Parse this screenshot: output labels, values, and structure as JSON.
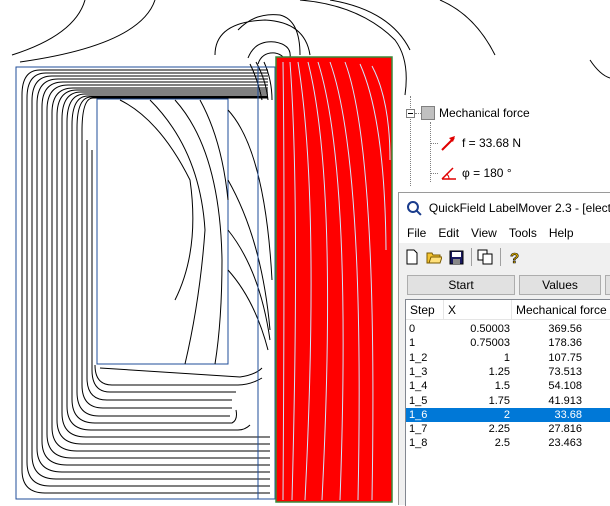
{
  "tree": {
    "node_label": "Mechanical force",
    "force_label": "f = 33.68 N",
    "angle_label": "φ = 180 °"
  },
  "window": {
    "title": "QuickField LabelMover 2.3 - [elect",
    "menu": [
      "File",
      "Edit",
      "View",
      "Tools",
      "Help"
    ],
    "toolbar_icons": [
      "new-icon",
      "open-icon",
      "save-icon",
      "copy-icon",
      "help-icon"
    ],
    "start_label": "Start",
    "values_label": "Values",
    "table": {
      "columns": [
        "Step",
        "X",
        "Mechanical force"
      ],
      "rows": [
        {
          "step": "0",
          "x": "0.50003",
          "force": "369.56"
        },
        {
          "step": "1",
          "x": "0.75003",
          "force": "178.36"
        },
        {
          "step": "1_2",
          "x": "1",
          "force": "107.75"
        },
        {
          "step": "1_3",
          "x": "1.25",
          "force": "73.513"
        },
        {
          "step": "1_4",
          "x": "1.5",
          "force": "54.108"
        },
        {
          "step": "1_5",
          "x": "1.75",
          "force": "41.913"
        },
        {
          "step": "1_6",
          "x": "2",
          "force": "33.68"
        },
        {
          "step": "1_7",
          "x": "2.25",
          "force": "27.816"
        },
        {
          "step": "1_8",
          "x": "2.5",
          "force": "23.463"
        }
      ],
      "selected_index": 6
    }
  },
  "colors": {
    "armature": "#ff0000",
    "selection": "#0078d7",
    "outline": "#1f4e9a"
  }
}
